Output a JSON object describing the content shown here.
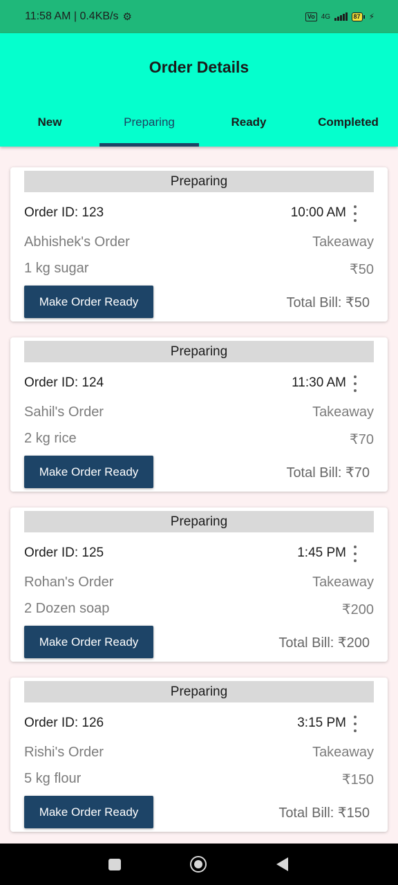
{
  "status_bar": {
    "time_speed": "11:58 AM | 0.4KB/s",
    "network_label": "4G",
    "battery": "87"
  },
  "app_bar": {
    "title": "Order Details",
    "tabs": [
      {
        "label": "New",
        "active": false
      },
      {
        "label": "Preparing",
        "active": true
      },
      {
        "label": "Ready",
        "active": false
      },
      {
        "label": "Completed",
        "active": false
      }
    ]
  },
  "orders": [
    {
      "status": "Preparing",
      "order_id": "Order ID: 123",
      "time": "10:00 AM",
      "customer": "Abhishek's Order",
      "type": "Takeaway",
      "item": "1 kg sugar",
      "price": "₹50",
      "button": "Make Order Ready",
      "total": "Total Bill: ₹50"
    },
    {
      "status": "Preparing",
      "order_id": "Order ID: 124",
      "time": "11:30 AM",
      "customer": "Sahil's Order",
      "type": "Takeaway",
      "item": "2 kg rice",
      "price": "₹70",
      "button": "Make Order Ready",
      "total": "Total Bill: ₹70"
    },
    {
      "status": "Preparing",
      "order_id": "Order ID: 125",
      "time": "1:45 PM",
      "customer": "Rohan's Order",
      "type": "Takeaway",
      "item": "2 Dozen soap",
      "price": "₹200",
      "button": "Make Order Ready",
      "total": "Total Bill: ₹200"
    },
    {
      "status": "Preparing",
      "order_id": "Order ID: 126",
      "time": "3:15 PM",
      "customer": "Rishi's Order",
      "type": "Takeaway",
      "item": "5 kg flour",
      "price": "₹150",
      "button": "Make Order Ready",
      "total": "Total Bill: ₹150"
    }
  ],
  "colors": {
    "app_bar_bg": "#05ffcd",
    "status_bar_bg": "#1fb87a",
    "button_bg": "#1d4467",
    "tab_indicator": "#1c4564"
  },
  "icons": {
    "settings": "gear-icon",
    "more": "more-vert-icon",
    "nav_recents": "square-icon",
    "nav_home": "circle-icon",
    "nav_back": "triangle-back-icon"
  }
}
